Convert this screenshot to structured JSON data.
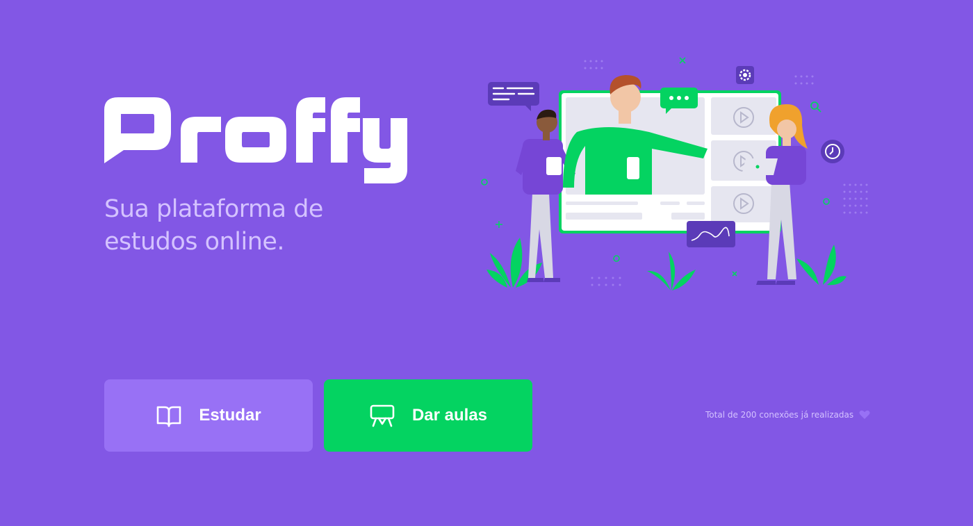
{
  "app": {
    "logo_text": "Proffy",
    "tagline_line1": "Sua plataforma de",
    "tagline_line2": "estudos online."
  },
  "hero": {
    "illustration_icons": [
      "chat-bubble-icon",
      "gear-icon",
      "clock-icon",
      "search-icon",
      "play-icon",
      "chart-icon"
    ]
  },
  "buttons": {
    "study": {
      "label": "Estudar",
      "icon": "book-icon"
    },
    "teach": {
      "label": "Dar aulas",
      "icon": "presentation-icon"
    }
  },
  "footer": {
    "connections_text": "Total de 200 conexões já realizadas",
    "icon": "heart-icon"
  },
  "colors": {
    "background": "#8257E5",
    "study_button": "#9871F5",
    "teach_button": "#04D361",
    "text_light": "#D4C2FF",
    "white": "#FFFFFF"
  }
}
